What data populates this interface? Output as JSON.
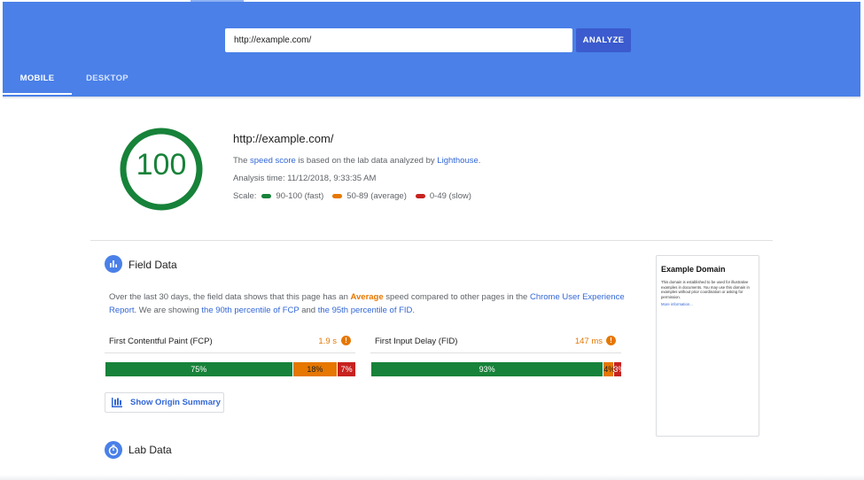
{
  "header": {
    "url_value": "http://example.com/",
    "analyze_label": "ANALYZE",
    "tabs": [
      {
        "label": "MOBILE",
        "selected": true
      },
      {
        "label": "DESKTOP",
        "selected": false
      }
    ],
    "bg_color": "#4a80e8",
    "button_color": "#3b5bce"
  },
  "score": {
    "value": "100",
    "fraction": 1.0,
    "color": "#178239",
    "url": "http://example.com/",
    "desc_pre": "The ",
    "desc_link1": "speed score",
    "desc_mid": " is based on the lab data analyzed by ",
    "desc_link2": "Lighthouse",
    "desc_post": ".",
    "analysis_time": "Analysis time: 11/12/2018, 9:33:35 AM",
    "scale_label": "Scale:",
    "scale": [
      {
        "label": "90-100 (fast)",
        "color": "#178239"
      },
      {
        "label": "50-89 (average)",
        "color": "#e67700"
      },
      {
        "label": "0-49 (slow)",
        "color": "#c7221f"
      }
    ]
  },
  "field_data": {
    "title": "Field Data",
    "icon": "bar-chart-icon",
    "desc": {
      "t1": "Over the last 30 days, the field data shows that this page has an ",
      "avg": "Average",
      "t2": " speed compared to other pages in the ",
      "link1": "Chrome User Experience Report",
      "t3": ". We are showing ",
      "link2": "the 90th percentile of FCP",
      "t4": " and ",
      "link3": "the 95th percentile of FID",
      "t5": "."
    },
    "metrics": [
      {
        "label": "First Contentful Paint (FCP)",
        "value": "1.9 s",
        "fast": "75%",
        "avg": "18%",
        "slow": "7%",
        "fast_pct": 75,
        "avg_pct": 18,
        "slow_pct": 7
      },
      {
        "label": "First Input Delay (FID)",
        "value": "147 ms",
        "fast": "93%",
        "avg": "4%",
        "slow": "3%",
        "fast_pct": 93,
        "avg_pct": 4,
        "slow_pct": 3
      }
    ],
    "origin_button": "Show Origin Summary"
  },
  "thumbnail": {
    "title": "Example Domain",
    "body": "This domain is established to be used for illustrative examples in documents. You may use this domain in examples without prior coordination or asking for permission.",
    "link": "More information..."
  },
  "lab_data": {
    "title": "Lab Data",
    "icon": "stopwatch-icon"
  }
}
